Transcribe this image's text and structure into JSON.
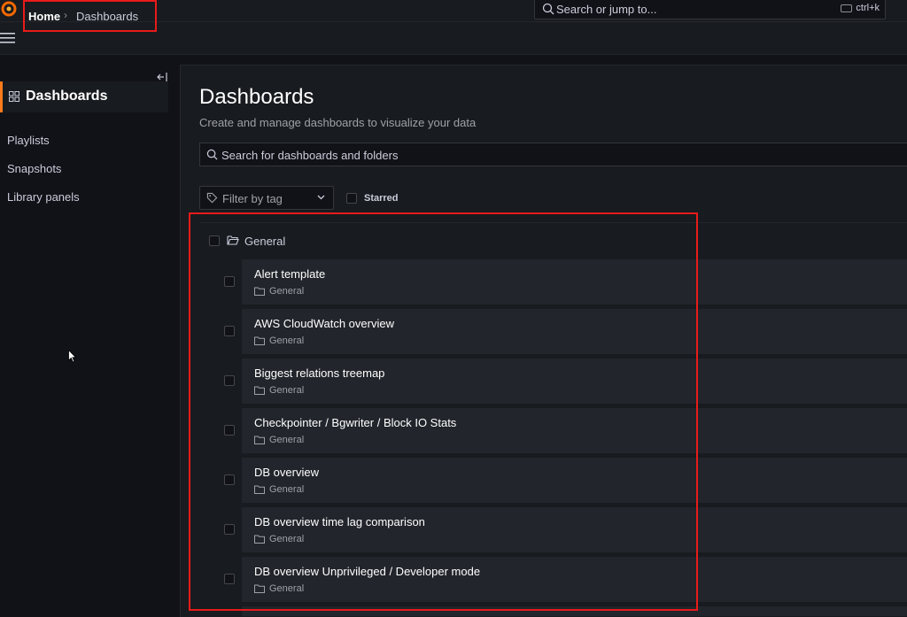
{
  "topbar": {
    "search_placeholder": "Search or jump to...",
    "shortcut": "ctrl+k"
  },
  "breadcrumb": {
    "home": "Home",
    "separator": "›",
    "current": "Dashboards"
  },
  "sidebar": {
    "active": "Dashboards",
    "items": [
      "Playlists",
      "Snapshots",
      "Library panels"
    ]
  },
  "main": {
    "title": "Dashboards",
    "subtitle": "Create and manage dashboards to visualize your data",
    "search_placeholder": "Search for dashboards and folders",
    "filter_label": "Filter by tag",
    "starred_label": "Starred",
    "folder": "General",
    "dashboards": [
      {
        "title": "Alert template",
        "folder": "General"
      },
      {
        "title": "AWS CloudWatch overview",
        "folder": "General"
      },
      {
        "title": "Biggest relations treemap",
        "folder": "General"
      },
      {
        "title": "Checkpointer / Bgwriter / Block IO Stats",
        "folder": "General"
      },
      {
        "title": "DB overview",
        "folder": "General"
      },
      {
        "title": "DB overview time lag comparison",
        "folder": "General"
      },
      {
        "title": "DB overview Unprivileged / Developer mode",
        "folder": "General"
      }
    ]
  },
  "colors": {
    "accent": "#ff7a1a",
    "highlight": "#e81b1b",
    "background": "#111217",
    "panel": "#181b1f"
  }
}
